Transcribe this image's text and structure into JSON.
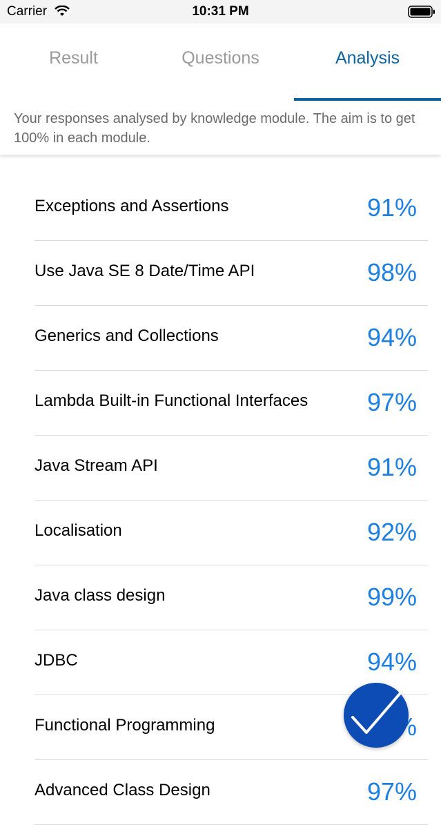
{
  "status_bar": {
    "carrier": "Carrier",
    "time": "10:31 PM"
  },
  "tabs": [
    {
      "label": "Result",
      "active": false
    },
    {
      "label": "Questions",
      "active": false
    },
    {
      "label": "Analysis",
      "active": true
    }
  ],
  "intro": "Your responses analysed by knowledge module. The aim is to get 100% in each module.",
  "modules": [
    {
      "name": "Exceptions and Assertions",
      "score": "91%"
    },
    {
      "name": "Use Java SE 8 Date/Time API",
      "score": "98%"
    },
    {
      "name": "Generics and Collections",
      "score": "94%"
    },
    {
      "name": "Lambda Built-in Functional Interfaces",
      "score": "97%"
    },
    {
      "name": "Java Stream API",
      "score": "91%"
    },
    {
      "name": "Localisation",
      "score": "92%"
    },
    {
      "name": "Java class design",
      "score": "99%"
    },
    {
      "name": "JDBC",
      "score": "94%"
    },
    {
      "name": "Functional Programming",
      "score": "%"
    },
    {
      "name": "Advanced Class Design",
      "score": "97%"
    }
  ],
  "colors": {
    "accent": "#0b63a0",
    "score": "#1d7fe0",
    "fab": "#0c4cb4"
  },
  "fab_icon": "checkmark-icon"
}
